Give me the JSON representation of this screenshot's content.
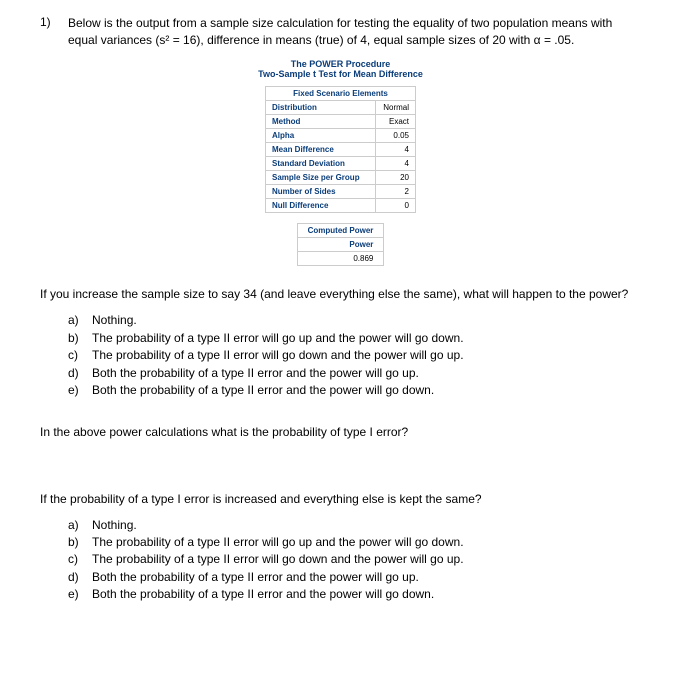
{
  "question_number": "1)",
  "question_text": "Below is the output from a sample size calculation for testing the equality of two population means with equal variances (s² = 16), difference in means (true) of 4, equal sample sizes of 20 with α = .05.",
  "power_output": {
    "title_line1": "The POWER Procedure",
    "title_line2": "Two-Sample t Test for Mean Difference",
    "scenario_table": {
      "header": "Fixed Scenario Elements",
      "rows": [
        {
          "label": "Distribution",
          "value": "Normal"
        },
        {
          "label": "Method",
          "value": "Exact"
        },
        {
          "label": "Alpha",
          "value": "0.05"
        },
        {
          "label": "Mean Difference",
          "value": "4"
        },
        {
          "label": "Standard Deviation",
          "value": "4"
        },
        {
          "label": "Sample Size per Group",
          "value": "20"
        },
        {
          "label": "Number of Sides",
          "value": "2"
        },
        {
          "label": "Null Difference",
          "value": "0"
        }
      ]
    },
    "computed_table": {
      "header": "Computed Power",
      "label": "Power",
      "value": "0.869"
    }
  },
  "q1": {
    "prompt": "If you increase the sample size to say 34 (and leave everything else the same), what will happen to the power?",
    "options": [
      {
        "letter": "a)",
        "text": "Nothing."
      },
      {
        "letter": "b)",
        "text": "The probability of a type II error will go up and the power will go down."
      },
      {
        "letter": "c)",
        "text": "The probability of a type II error will go down and the power will go up."
      },
      {
        "letter": "d)",
        "text": "Both the probability of a type II error and the power will go up."
      },
      {
        "letter": "e)",
        "text": "Both the probability of a type II error and the power will go down."
      }
    ]
  },
  "q2": {
    "prompt": "In the above power calculations what is the probability of type I error?"
  },
  "q3": {
    "prompt": "If the probability of a type I error is increased and everything else is kept the same?",
    "options": [
      {
        "letter": "a)",
        "text": "Nothing."
      },
      {
        "letter": "b)",
        "text": "The probability of a type II error will go up and the power will go down."
      },
      {
        "letter": "c)",
        "text": "The probability of a type II error will go down and the power will go up."
      },
      {
        "letter": "d)",
        "text": "Both the probability of a type II error and the power will go up."
      },
      {
        "letter": "e)",
        "text": "Both the probability of a type II error and the power will go down."
      }
    ]
  }
}
